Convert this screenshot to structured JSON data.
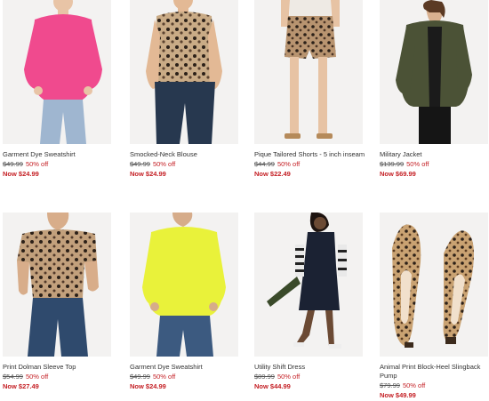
{
  "products": [
    {
      "name": "Garment Dye Sweatshirt",
      "original_price": "$49.99",
      "discount": "50% off",
      "sale_price": "Now $24.99",
      "image": "model in pink sweatshirt and light jeans"
    },
    {
      "name": "Smocked-Neck Blouse",
      "original_price": "$49.99",
      "discount": "50% off",
      "sale_price": "Now $24.99",
      "image": "model in leopard sleeveless blouse and dark jeans"
    },
    {
      "name": "Pique Tailored Shorts - 5 inch inseam",
      "original_price": "$44.99",
      "discount": "50% off",
      "sale_price": "Now $22.49",
      "image": "model in leopard print shorts and sandals"
    },
    {
      "name": "Military Jacket",
      "original_price": "$139.99",
      "discount": "50% off",
      "sale_price": "Now $69.99",
      "image": "model in olive military jacket"
    },
    {
      "name": "Print Dolman Sleeve Top",
      "original_price": "$54.99",
      "discount": "50% off",
      "sale_price": "Now $27.49",
      "image": "model in leopard dolman top and jeans"
    },
    {
      "name": "Garment Dye Sweatshirt",
      "original_price": "$49.99",
      "discount": "50% off",
      "sale_price": "Now $24.99",
      "image": "model in neon yellow sweatshirt"
    },
    {
      "name": "Utility Shift Dress",
      "original_price": "$89.99",
      "discount": "50% off",
      "sale_price": "Now $44.99",
      "image": "model in navy shift dress holding umbrella"
    },
    {
      "name": "Animal Print Block-Heel Slingback Pump",
      "original_price": "$79.99",
      "discount": "50% off",
      "sale_price": "Now $49.99",
      "image": "pair of leopard print slingback pumps"
    }
  ],
  "colors": {
    "sale_red": "#c41f24",
    "pink": "#f04a8e",
    "yellow": "#e9f23a",
    "olive": "#4b5236",
    "navy": "#1b2233",
    "denim": "#3c5a80",
    "leopard": "#b5926a"
  }
}
